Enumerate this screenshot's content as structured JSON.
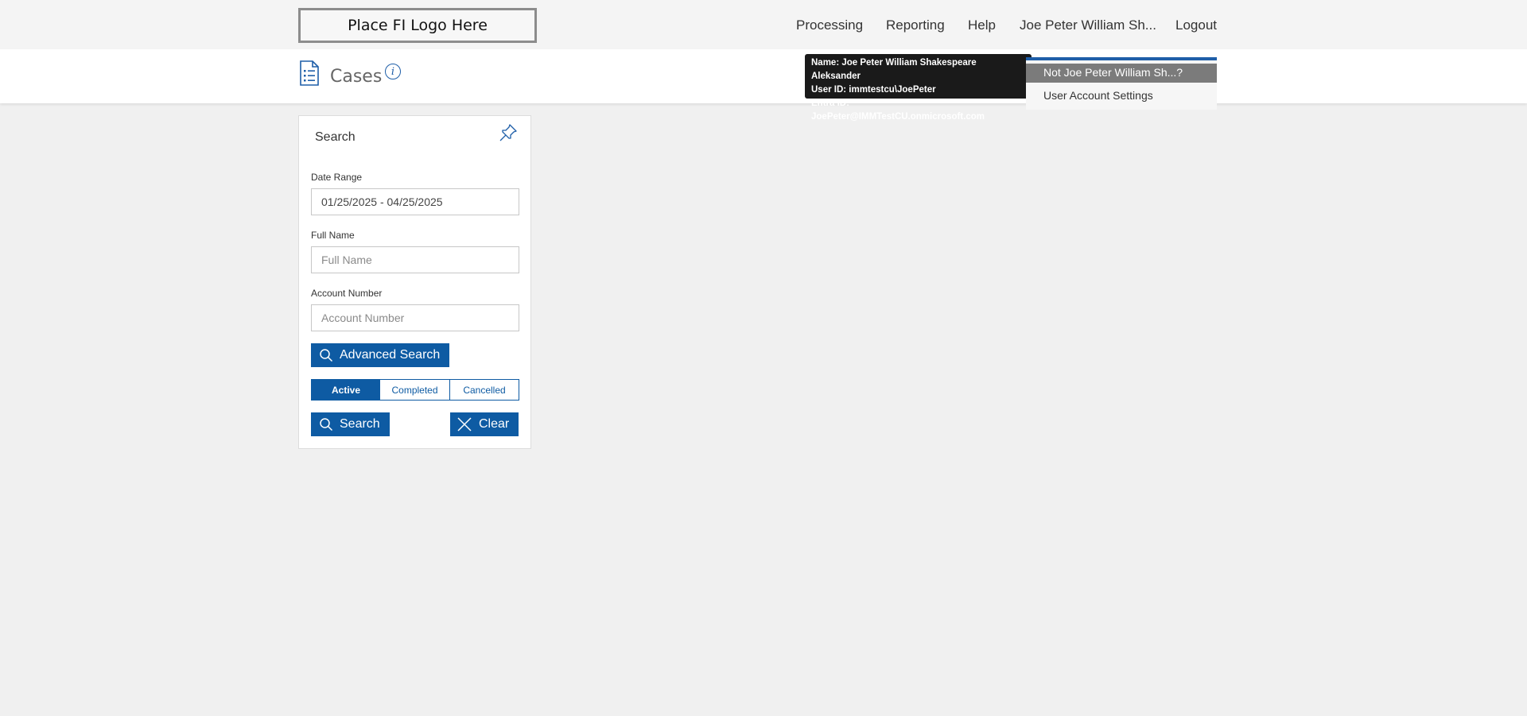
{
  "header": {
    "logo_text": "Place FI Logo Here",
    "nav": {
      "processing": "Processing",
      "reporting": "Reporting",
      "help": "Help",
      "user": "Joe Peter William Sh...",
      "logout": "Logout"
    }
  },
  "page": {
    "title": "Cases",
    "title_icon": "list-document-icon",
    "info_icon": "info-icon"
  },
  "tooltip": {
    "name": "Name: Joe Peter William Shakespeare Aleksander",
    "user_id": "User ID: immtestcu\\JoePeter",
    "entra_id": "Entra ID: JoePeter@IMMTestCU.onmicrosoft.com"
  },
  "user_menu": {
    "not_user": "Not Joe Peter William Sh...?",
    "settings": "User Account Settings"
  },
  "search_panel": {
    "title": "Search",
    "pin_icon": "pin-icon",
    "date_range": {
      "label": "Date Range",
      "value": "01/25/2025 - 04/25/2025"
    },
    "full_name": {
      "label": "Full Name",
      "placeholder": "Full Name"
    },
    "account_number": {
      "label": "Account Number",
      "placeholder": "Account Number"
    },
    "advanced_search_label": "Advanced Search",
    "status_tabs": {
      "active": "Active",
      "completed": "Completed",
      "cancelled": "Cancelled",
      "selected": "Active"
    },
    "search_label": "Search",
    "clear_label": "Clear"
  },
  "colors": {
    "accent": "#0e5ba3",
    "header_bg": "#f4f4f4",
    "page_bg": "#f0f0f0",
    "menu_highlight": "#7b7b7b"
  }
}
